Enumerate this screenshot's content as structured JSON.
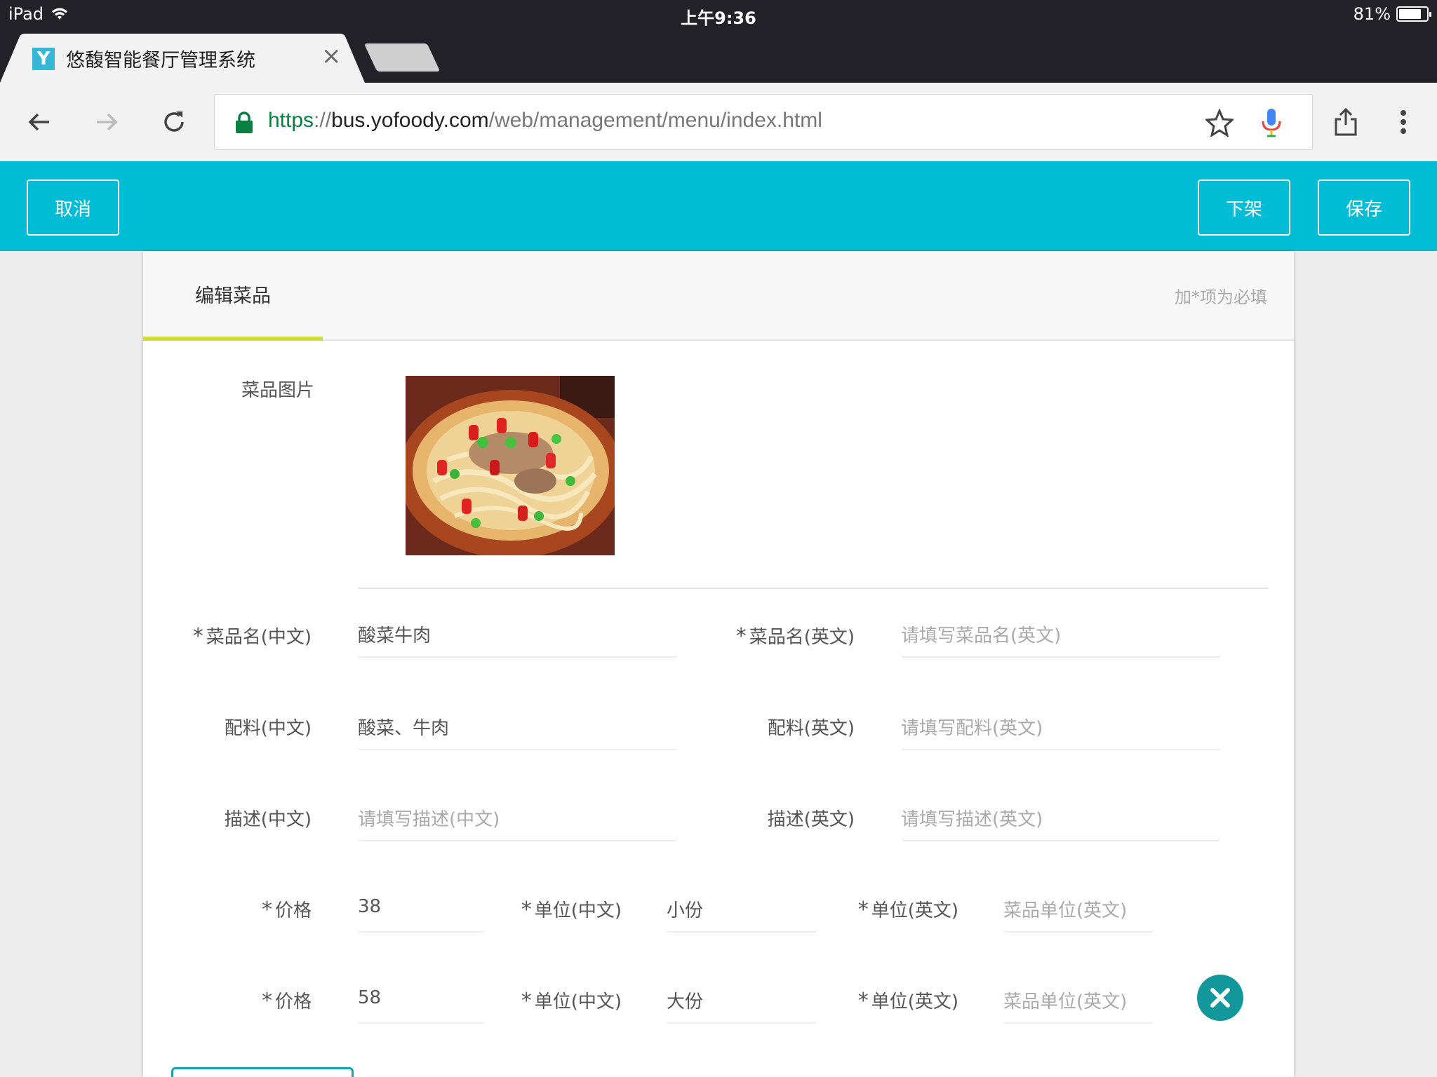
{
  "status_bar": {
    "device": "iPad",
    "time": "上午9:36",
    "battery": "81%",
    "battery_level": 0.81
  },
  "browser": {
    "tab_title": "悠馥智能餐厅管理系统",
    "favicon_letter": "Y",
    "url_scheme": "https",
    "url_sep": "://",
    "url_host": "bus.yofoody.com",
    "url_path": "/web/management/menu/index.html",
    "icons": [
      "back-arrow-icon",
      "forward-arrow-icon",
      "reload-icon",
      "lock-icon",
      "star-icon",
      "microphone-icon",
      "share-icon",
      "more-vert-icon"
    ]
  },
  "header": {
    "cancel_label": "取消",
    "offshelf_label": "下架",
    "save_label": "保存",
    "bg_color": "#00bcd4"
  },
  "card": {
    "tab_label": "编辑菜品",
    "required_note": "加*项为必填",
    "image_label": "菜品图片",
    "fields": {
      "name_cn_label": "菜品名(中文)",
      "name_cn_value": "酸菜牛肉",
      "name_en_label": "菜品名(英文)",
      "name_en_placeholder": "请填写菜品名(英文)",
      "ingredients_cn_label": "配料(中文)",
      "ingredients_cn_value": "酸菜、牛肉",
      "ingredients_en_label": "配料(英文)",
      "ingredients_en_placeholder": "请填写配料(英文)",
      "desc_cn_label": "描述(中文)",
      "desc_cn_placeholder": "请填写描述(中文)",
      "desc_en_label": "描述(英文)",
      "desc_en_placeholder": "请填写描述(英文)"
    },
    "price_rows": [
      {
        "price_label": "价格",
        "price_value": "38",
        "unit_cn_label": "单位(中文)",
        "unit_cn_value": "小份",
        "unit_en_label": "单位(英文)",
        "unit_en_placeholder": "菜品单位(英文)"
      },
      {
        "price_label": "价格",
        "price_value": "58",
        "unit_cn_label": "单位(中文)",
        "unit_cn_value": "大份",
        "unit_en_label": "单位(英文)",
        "unit_en_placeholder": "菜品单位(英文)"
      }
    ],
    "accent_color": "#cddc39",
    "remove_color": "#12979a"
  }
}
